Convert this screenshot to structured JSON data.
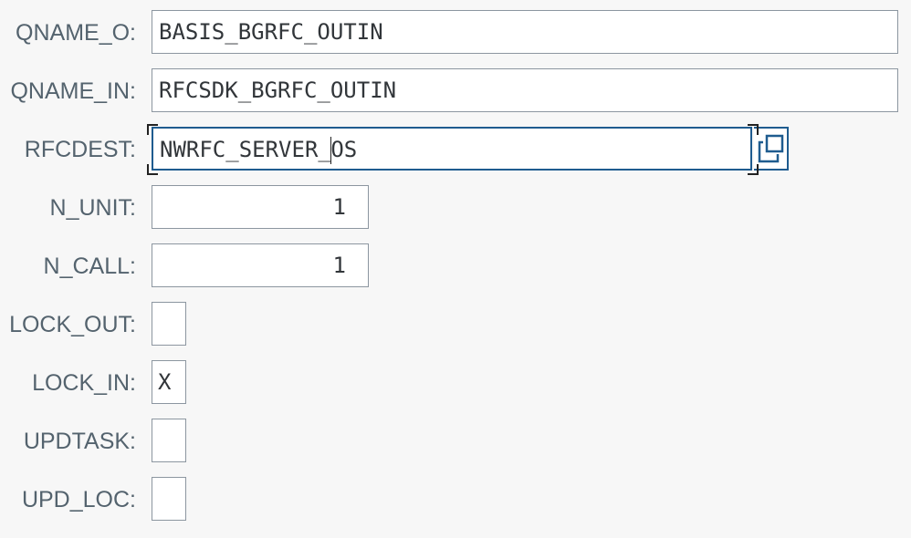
{
  "fields": [
    {
      "label": "QNAME_O:",
      "value": "BASIS_BGRFC_OUTIN"
    },
    {
      "label": "QNAME_IN:",
      "value": "RFCSDK_BGRFC_OUTIN"
    },
    {
      "label": "RFCDEST:",
      "value_before_caret": "NWRFC_SERVER_",
      "value_after_caret": "OS"
    },
    {
      "label": "N_UNIT:",
      "value": "1"
    },
    {
      "label": "N_CALL:",
      "value": "1"
    },
    {
      "label": "LOCK_OUT:",
      "value": ""
    },
    {
      "label": "LOCK_IN:",
      "value": "X"
    },
    {
      "label": "UPDTASK:",
      "value": ""
    },
    {
      "label": "UPD_LOC:",
      "value": ""
    }
  ],
  "icons": {
    "value_help": "value-help-icon"
  },
  "colors": {
    "label": "#54636e",
    "focus_border": "#1f5c8f",
    "field_border": "#8c96a0"
  }
}
